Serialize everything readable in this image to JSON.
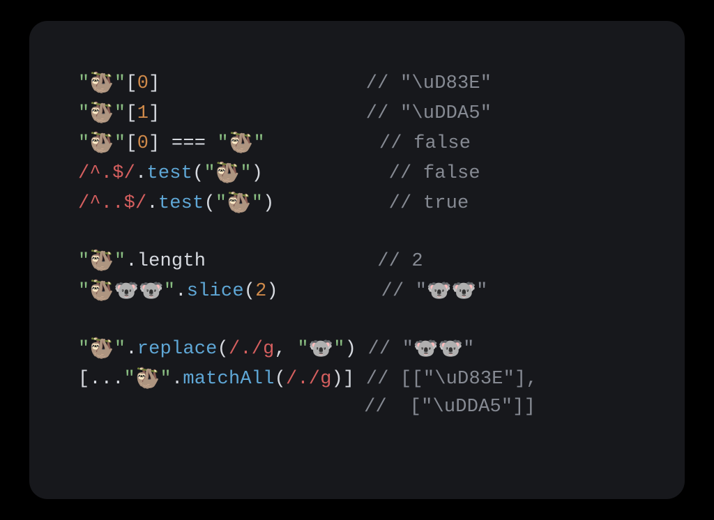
{
  "emoji": {
    "sloth": "🦥",
    "koala": "🐨",
    "koala2": "🐨🐨",
    "slothKoala2": "🦥🐨🐨"
  },
  "q": "\"",
  "dot": ".",
  "ob": "[",
  "cb": "]",
  "op": "(",
  "cp": ")",
  "eqeq": " === ",
  "spread": "[...",
  "closeArr": "]",
  "comma": ", ",
  "num": {
    "zero": "0",
    "one": "1",
    "two": "2"
  },
  "regex": {
    "caretDotEnd": "/^.$/",
    "caretDotDotEnd": "/^..$/",
    "anyG": "/./g"
  },
  "fn": {
    "test": "test",
    "length": "length",
    "slice": "slice",
    "replace": "replace",
    "matchAll": "matchAll"
  },
  "pad": {
    "l1": "                  ",
    "l2": "                  ",
    "l3": "          ",
    "l4": "           ",
    "l5": "          ",
    "l6": "               ",
    "l7": "         ",
    "l8": " ",
    "l9": " ",
    "l10": "                         "
  },
  "cm": {
    "l1": "// \"\\uD83E\"",
    "l2": "// \"\\uDDA5\"",
    "l3": "// false",
    "l4": "// false",
    "l5": "// true",
    "l6": "// 2",
    "l7a": "// \"",
    "l7b": "\"",
    "l8a": "// \"",
    "l8b": "\"",
    "l9": "// [[\"\\uD83E\"],",
    "l10": "//  [\"\\uDDA5\"]]"
  }
}
